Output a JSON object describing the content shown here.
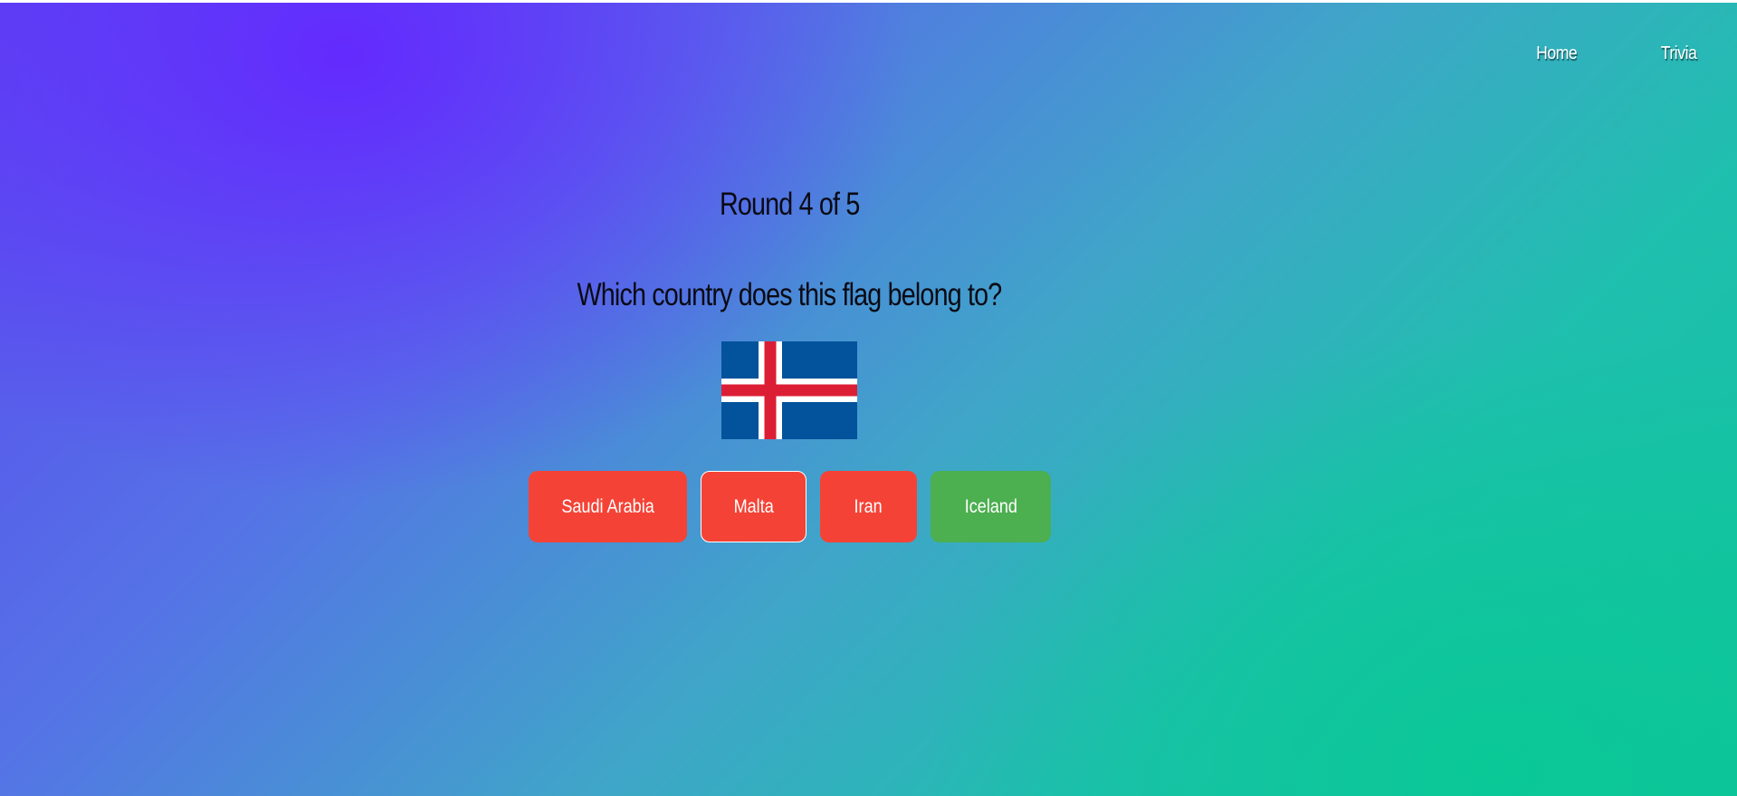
{
  "nav": {
    "home_label": "Home",
    "trivia_label": "Trivia"
  },
  "game": {
    "round_text": "Round 4 of 5",
    "question": "Which country does this flag belong to?",
    "flag_icon": "iceland-flag",
    "answers": [
      {
        "label": "Saudi Arabia",
        "state": "wrong",
        "color": "#f44336"
      },
      {
        "label": "Malta",
        "state": "selected-wrong",
        "color": "#f44336"
      },
      {
        "label": "Iran",
        "state": "wrong",
        "color": "#f44336"
      },
      {
        "label": "Iceland",
        "state": "correct",
        "color": "#4caf50"
      }
    ]
  },
  "colors": {
    "gradient_start": "#6433ff",
    "gradient_end": "#0ec49c",
    "wrong": "#f44336",
    "correct": "#4caf50",
    "flag_blue": "#02529c",
    "flag_red": "#dc1e35"
  }
}
